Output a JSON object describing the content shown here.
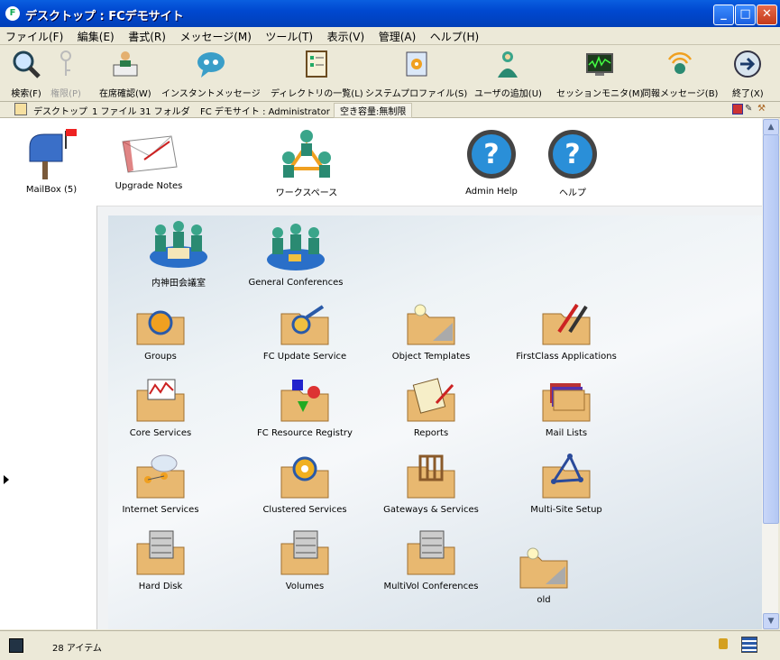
{
  "window": {
    "title": "デスクトップ : FCデモサイト"
  },
  "menu": [
    "ファイル(F)",
    "編集(E)",
    "書式(R)",
    "メッセージ(M)",
    "ツール(T)",
    "表示(V)",
    "管理(A)",
    "ヘルプ(H)"
  ],
  "toolbar": {
    "search": "検索(F)",
    "permissions": "権限(P)",
    "presence": "在席確認(W)",
    "instant_message": "インスタントメッセージ",
    "directory": "ディレクトリの一覧(L)",
    "system_profile": "システムプロファイル(S)",
    "add_user": "ユーザの追加(U)",
    "session_monitor": "セッションモニタ(M)",
    "broadcast": "同報メッセージ(B)",
    "exit": "終了(X)"
  },
  "pathbar": {
    "location": "デスクトップ",
    "files": "1 ファイル 31 フォルダ",
    "site_user": "FC デモサイト : Administrator",
    "quota": "空き容量:無制限"
  },
  "desktop_icons": {
    "mailbox": "MailBox (5)",
    "upgrade_notes": "Upgrade Notes",
    "workspace": "ワークスペース",
    "admin_help": "Admin Help",
    "help": "ヘルプ"
  },
  "panel_icons": {
    "conference_room": "内神田会議室",
    "general_conferences": "General Conferences",
    "groups": "Groups",
    "update_service": "FC Update Service",
    "object_templates": "Object Templates",
    "firstclass_apps": "FirstClass Applications",
    "core_services": "Core Services",
    "resource_registry": "FC Resource Registry",
    "reports": "Reports",
    "mail_lists": "Mail Lists",
    "internet_services": "Internet Services",
    "clustered_services": "Clustered Services",
    "gateways": "Gateways & Services",
    "multisite": "Multi-Site Setup",
    "hard_disk": "Hard Disk",
    "volumes": "Volumes",
    "multivol": "MultiVol Conferences",
    "old": "old"
  },
  "status": {
    "items": "28 アイテム"
  }
}
